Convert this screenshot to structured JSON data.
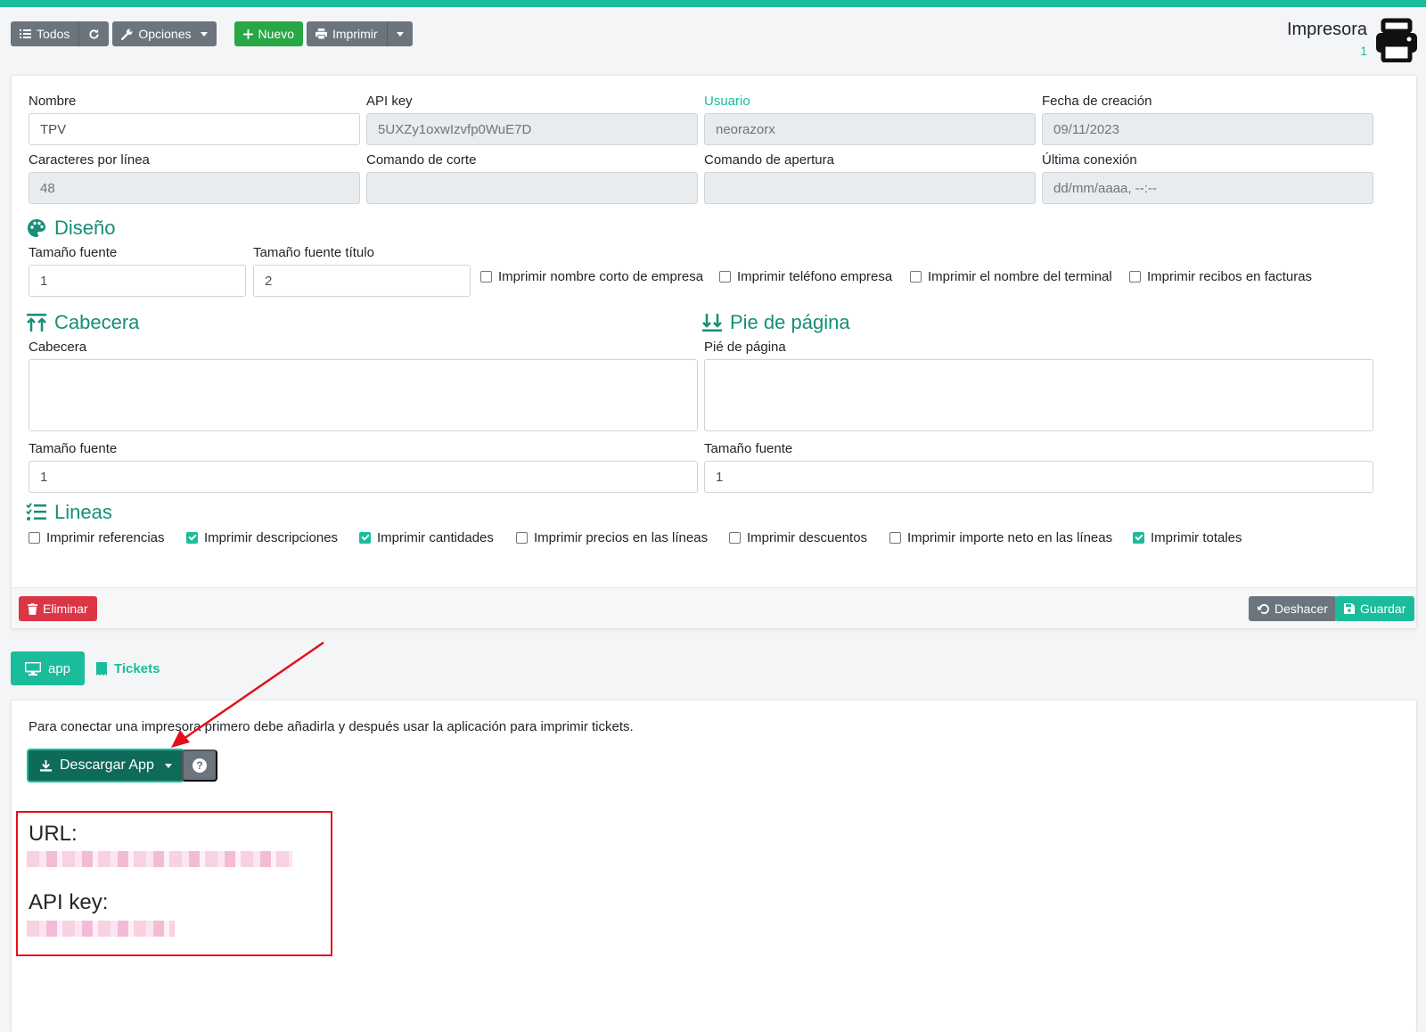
{
  "toolbar": {
    "todos": "Todos",
    "opciones": "Opciones",
    "nuevo": "Nuevo",
    "imprimir": "Imprimir"
  },
  "page": {
    "title": "Impresora",
    "count": "1"
  },
  "form": {
    "nombre": {
      "label": "Nombre",
      "value": "TPV"
    },
    "api_key": {
      "label": "API key",
      "value": "5UXZy1oxwIzvfp0WuE7D"
    },
    "usuario": {
      "label": "Usuario",
      "value": "neorazorx"
    },
    "fecha_creacion": {
      "label": "Fecha de creación",
      "value": "09/11/2023"
    },
    "caracteres_linea": {
      "label": "Caracteres por línea",
      "value": "48"
    },
    "comando_corte": {
      "label": "Comando de corte",
      "value": ""
    },
    "comando_apertura": {
      "label": "Comando de apertura",
      "value": ""
    },
    "ultima_conexion": {
      "label": "Última conexión",
      "value": "dd/mm/aaaa, --:--"
    }
  },
  "diseno": {
    "title": "Diseño",
    "tamano_fuente": {
      "label": "Tamaño fuente",
      "value": "1"
    },
    "tamano_fuente_titulo": {
      "label": "Tamaño fuente título",
      "value": "2"
    },
    "checks": [
      {
        "label": "Imprimir nombre corto de empresa",
        "checked": false
      },
      {
        "label": "Imprimir teléfono empresa",
        "checked": false
      },
      {
        "label": "Imprimir el nombre del terminal",
        "checked": false
      },
      {
        "label": "Imprimir recibos en facturas",
        "checked": false
      }
    ]
  },
  "cabecera": {
    "title": "Cabecera",
    "label": "Cabecera",
    "font_label": "Tamaño fuente",
    "font_value": "1"
  },
  "pie": {
    "title": "Pie de página",
    "label": "Pié de página",
    "font_label": "Tamaño fuente",
    "font_value": "1"
  },
  "lineas": {
    "title": "Lineas",
    "checks": [
      {
        "label": "Imprimir referencias",
        "checked": false
      },
      {
        "label": "Imprimir descripciones",
        "checked": true
      },
      {
        "label": "Imprimir cantidades",
        "checked": true
      },
      {
        "label": "Imprimir precios en las líneas",
        "checked": false
      },
      {
        "label": "Imprimir descuentos",
        "checked": false
      },
      {
        "label": "Imprimir importe neto en las líneas",
        "checked": false
      },
      {
        "label": "Imprimir totales",
        "checked": true
      }
    ]
  },
  "footer": {
    "eliminar": "Eliminar",
    "deshacer": "Deshacer",
    "guardar": "Guardar"
  },
  "tabs": {
    "app": "app",
    "tickets": "Tickets"
  },
  "app_panel": {
    "info": "Para conectar una impresora primero debe añadirla y después usar la aplicación para imprimir tickets.",
    "download": "Descargar App",
    "help": "?",
    "url_label": "URL:",
    "api_key_label": "API key:"
  },
  "colors": {
    "accent": "#1abc9c",
    "accent_dark": "#168f76",
    "danger": "#dc3545",
    "secondary": "#6c757d",
    "success": "#28a745",
    "annotation": "#e3101a"
  }
}
